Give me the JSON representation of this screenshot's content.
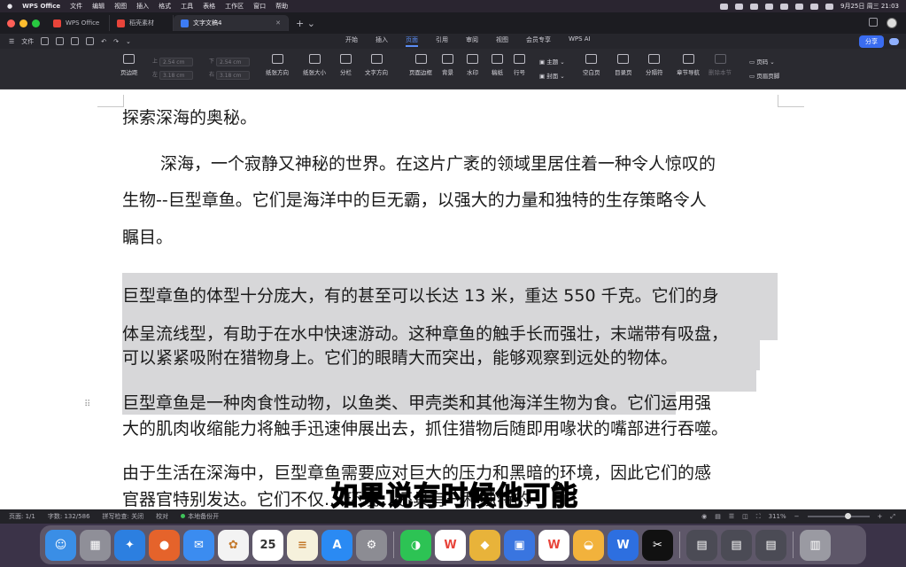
{
  "menubar": {
    "app": "WPS Office",
    "items": [
      "文件",
      "编辑",
      "视图",
      "插入",
      "格式",
      "工具",
      "表格",
      "工作区",
      "窗口",
      "帮助"
    ],
    "datetime": "9月25日 周三 21:03"
  },
  "tabs": [
    {
      "label": "WPS Office",
      "color": "#e8443a"
    },
    {
      "label": "稻壳素材",
      "color": "#e8443a"
    },
    {
      "label": "文字文稿4",
      "color": "#3d7cf5"
    }
  ],
  "quickaccess": {
    "file": "文件"
  },
  "ribbon_tabs": [
    "开始",
    "插入",
    "页面",
    "引用",
    "审阅",
    "视图",
    "会员专享",
    "WPS AI"
  ],
  "ribbon_active": "页面",
  "share_label": "分享",
  "toolbar": {
    "page_margin": "页边距",
    "top_label": "上",
    "top_val": "2.54",
    "bottom_label": "下",
    "bottom_val": "2.54",
    "left_label": "左",
    "left_val": "3.18",
    "right_label": "右",
    "right_val": "3.18",
    "unit": "cm",
    "orientation": "纸张方向",
    "size": "纸张大小",
    "columns": "分栏",
    "text_dir": "文字方向",
    "page_border": "页面边框",
    "background": "背景",
    "watermark": "水印",
    "draft": "稿纸",
    "line_num": "行号",
    "theme": "主题",
    "cover": "封面",
    "blank_page": "空白页",
    "toc_page": "目录页",
    "page_break": "分隔符",
    "section_nav": "章节导航",
    "delete_section": "删除本节",
    "page_number": "页码",
    "header_footer": "页眉页脚"
  },
  "document": {
    "title": "探索深海的奥秘。",
    "p1_l1": "深海，一个寂静又神秘的世界。在这片广袤的领域里居住着一种令人惊叹的",
    "p1_l2": "生物--巨型章鱼。它们是海洋中的巨无霸，以强大的力量和独特的生存策略令人",
    "p1_l3": "瞩目。",
    "p2_l1": "巨型章鱼的体型十分庞大，有的甚至可以长达 13 米，重达 550 千克。它们的身",
    "p2_l2": "体呈流线型，有助于在水中快速游动。这种章鱼的触手长而强壮，末端带有吸盘，",
    "p2_l3": "可以紧紧吸附在猎物身上。它们的眼睛大而突出，能够观察到远处的物体。",
    "p3_l1": "巨型章鱼是一种肉食性动物，以鱼类、甲壳类和其他海洋生物为食。它们运用强",
    "p3_l2": "大的肌肉收缩能力将触手迅速伸展出去，抓住猎物后随即用喙状的嘴部进行吞噬。",
    "p4_l1": "由于生活在深海中，巨型章鱼需要应对巨大的压力和黑暗的环境，因此它们的感",
    "p4_l2": "官器官特别发达。它们不仅... 环境，还具有一种独特的"
  },
  "subtitle": "如果说有时候他可能",
  "status": {
    "page": "页面: 1/1",
    "words": "字数: 132/586",
    "spell": "拼写检查: 关闭",
    "proof": "校对",
    "backup": "本地备份开",
    "zoom": "311%"
  },
  "dock": [
    {
      "name": "finder",
      "color": "#3a8ee6",
      "glyph": "☺"
    },
    {
      "name": "launchpad",
      "color": "#8f8f98",
      "glyph": "▦"
    },
    {
      "name": "safari",
      "color": "#2c7fe0",
      "glyph": "✦"
    },
    {
      "name": "firefox",
      "color": "#e5632b",
      "glyph": "●"
    },
    {
      "name": "mail",
      "color": "#3b8cf0",
      "glyph": "✉"
    },
    {
      "name": "photos",
      "color": "#f3f3f3",
      "glyph": "✿"
    },
    {
      "name": "calendar",
      "color": "#ffffff",
      "glyph": "25"
    },
    {
      "name": "notes",
      "color": "#f6f1dc",
      "glyph": "≡"
    },
    {
      "name": "app-store",
      "color": "#2a8af3",
      "glyph": "A"
    },
    {
      "name": "system-settings",
      "color": "#8c8c93",
      "glyph": "⚙"
    },
    {
      "name": "wechat",
      "color": "#2dc354",
      "glyph": "◑"
    },
    {
      "name": "wps",
      "color": "#ffffff",
      "glyph": "W"
    },
    {
      "name": "security",
      "color": "#e8b33a",
      "glyph": "◆"
    },
    {
      "name": "screen-tool",
      "color": "#3975e0",
      "glyph": "▣"
    },
    {
      "name": "wps-writer",
      "color": "#ffffff",
      "glyph": "W"
    },
    {
      "name": "toolbox",
      "color": "#f2b23c",
      "glyph": "◒"
    },
    {
      "name": "wps-word",
      "color": "#2d6fe0",
      "glyph": "W"
    },
    {
      "name": "capcut",
      "color": "#111111",
      "glyph": "✂"
    },
    {
      "name": "window-thumb-1",
      "color": "#4b4b55",
      "glyph": "▤"
    },
    {
      "name": "window-thumb-2",
      "color": "#4b4b55",
      "glyph": "▤"
    },
    {
      "name": "window-thumb-3",
      "color": "#4b4b55",
      "glyph": "▤"
    },
    {
      "name": "trash",
      "color": "#9a9aa2",
      "glyph": "▥"
    }
  ],
  "colors": {
    "accent": "#3a6cf0",
    "highlight": "#d7d7d9"
  }
}
